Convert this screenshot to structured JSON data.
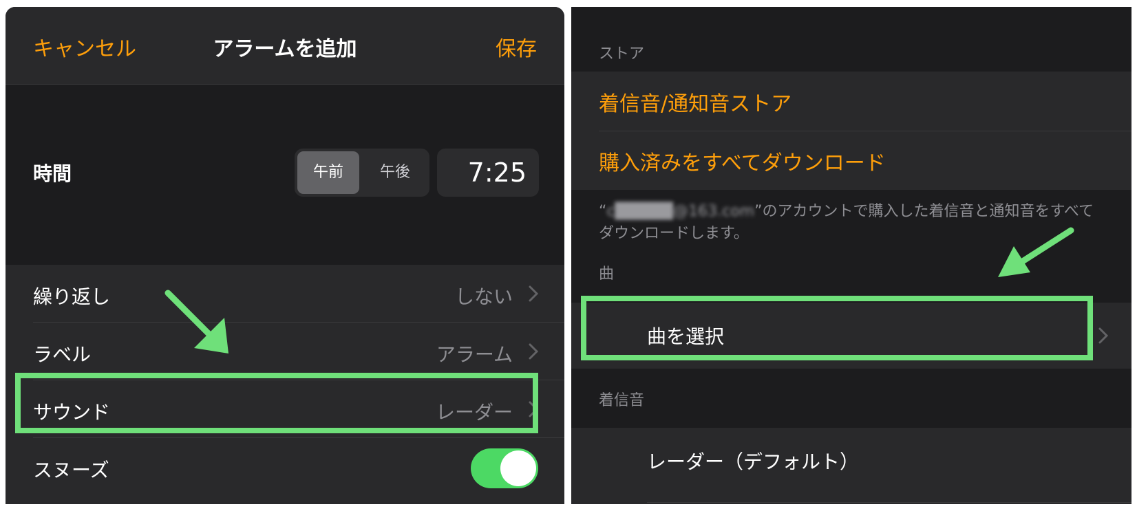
{
  "left": {
    "nav": {
      "cancel": "キャンセル",
      "title": "アラームを追加",
      "save": "保存"
    },
    "time": {
      "label": "時間",
      "am": "午前",
      "pm": "午後",
      "value": "7:25"
    },
    "rows": [
      {
        "label": "繰り返し",
        "value": "しない"
      },
      {
        "label": "ラベル",
        "value": "アラーム"
      },
      {
        "label": "サウンド",
        "value": "レーダー"
      },
      {
        "label": "スヌーズ",
        "toggle_on": true
      }
    ]
  },
  "right": {
    "store_header": "ストア",
    "store_items": [
      "着信音/通知音ストア",
      "購入済みをすべてダウンロード"
    ],
    "footnote_prefix": "“",
    "footnote_account": "c█████@163.com",
    "footnote_suffix": "”のアカウントで購入した着信音と通知音をすべてダウンロードします。",
    "song_header": "曲",
    "song_select": "曲を選択",
    "ringtone_header": "着信音",
    "ringtone_first": "レーダー（デフォルト）"
  },
  "colors": {
    "accent": "#ff9f0a",
    "highlight": "#6fe07a",
    "toggle_on": "#4cd964",
    "background": "#1c1c1e",
    "cell": "#29292b"
  },
  "icons": [
    "chevron-right-icon",
    "green-arrow-annotation"
  ]
}
